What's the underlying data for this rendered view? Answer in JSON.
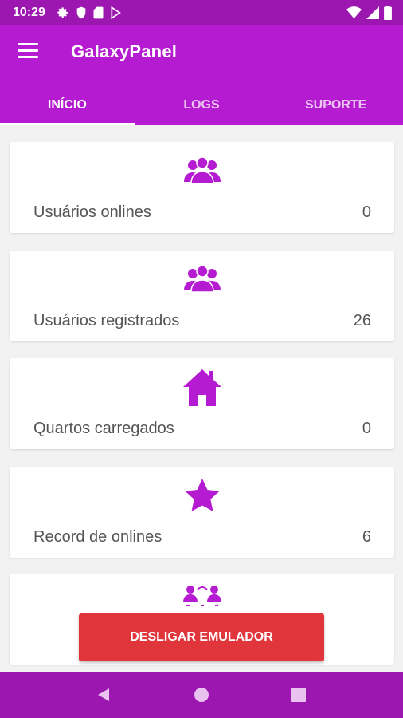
{
  "status_bar": {
    "time": "10:29",
    "left_icons": [
      "settings-icon",
      "shield-icon",
      "sd-card-icon",
      "play-store-icon"
    ],
    "right_icons": [
      "wifi-icon",
      "cellular-signal-icon",
      "battery-icon"
    ]
  },
  "app_bar": {
    "title": "GalaxyPanel",
    "menu_icon": "menu-icon"
  },
  "tabs": [
    {
      "label": "INÍCIO",
      "active": true
    },
    {
      "label": "LOGS",
      "active": false
    },
    {
      "label": "SUPORTE",
      "active": false
    }
  ],
  "cards": [
    {
      "icon": "users-group-icon",
      "label": "Usuários onlines",
      "value": "0"
    },
    {
      "icon": "users-group-icon",
      "label": "Usuários registrados",
      "value": "26"
    },
    {
      "icon": "home-icon",
      "label": "Quartos carregados",
      "value": "0"
    },
    {
      "icon": "star-icon",
      "label": "Record de onlines",
      "value": "6"
    },
    {
      "icon": "users-exchange-icon",
      "label": "",
      "value": ""
    }
  ],
  "shutdown_button": {
    "label": "DESLIGAR EMULADOR"
  },
  "nav_bar": {
    "icons": [
      "back-icon",
      "home-circle-icon",
      "recents-icon"
    ]
  },
  "colors": {
    "status_bar": "#9c16b0",
    "app_bar": "#b51bd0",
    "accent_icon": "#b51bd0",
    "background": "#f2f2f2",
    "shutdown_button": "#e0353a"
  }
}
